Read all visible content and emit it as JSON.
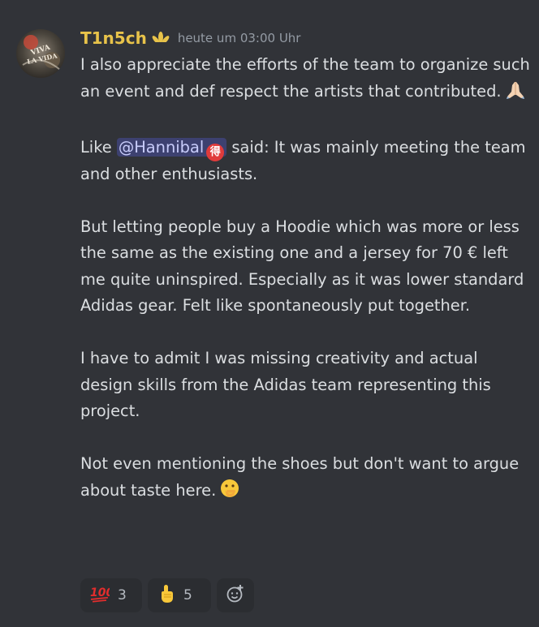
{
  "message": {
    "author": "T1n5ch",
    "author_color": "#e8c34a",
    "role_icon": "adidas-trefoil-icon",
    "timestamp": "heute um 03:00 Uhr",
    "paragraphs": {
      "p1": "I also appreciate the efforts of the team to organize such an event and def respect the artists that contributed.",
      "p1_emoji": "folded-hands-emoji",
      "p2_before": "Like ",
      "mention": "@Hannibal",
      "mention_badge": "得",
      "p2_after": " said: It was mainly meeting the team and other enthusiasts.",
      "p3": "But letting people buy a Hoodie which was more or less the same as the existing one and a jersey for 70 € left me quite uninspired. Especially as it was lower standard Adidas gear. Felt like spontaneously put together.",
      "p4": "I have to admit I was missing creativity and actual design skills from the Adidas team representing this project.",
      "p5": "Not even mentioning the shoes but don't want to argue about taste here.",
      "p5_emoji": "face-with-hand-over-mouth-emoji"
    },
    "reactions": [
      {
        "emoji": "hundred-points-emoji",
        "count": "3"
      },
      {
        "emoji": "index-pointing-up-emoji",
        "count": "5"
      }
    ],
    "add_reaction_icon": "add-reaction-icon"
  },
  "colors": {
    "background": "#313338",
    "text": "#dbdee1",
    "muted": "#949ba4",
    "mention_bg": "#4a4f8f",
    "reaction_bg": "#2b2d31"
  }
}
